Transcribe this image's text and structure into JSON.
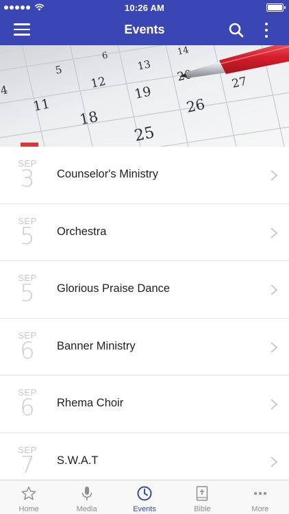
{
  "status_bar": {
    "time": "10:26 AM"
  },
  "nav": {
    "title": "Events"
  },
  "hero": {
    "calendar_numbers": [
      "4",
      "5",
      "6",
      "12",
      "13",
      "14",
      "11",
      "19",
      "20",
      "27",
      "18",
      "26",
      "25"
    ]
  },
  "events": [
    {
      "month": "SEP",
      "day": "3",
      "title": "Counselor's Ministry"
    },
    {
      "month": "SEP",
      "day": "5",
      "title": "Orchestra"
    },
    {
      "month": "SEP",
      "day": "5",
      "title": "Glorious Praise Dance"
    },
    {
      "month": "SEP",
      "day": "6",
      "title": "Banner Ministry"
    },
    {
      "month": "SEP",
      "day": "6",
      "title": "Rhema Choir"
    },
    {
      "month": "SEP",
      "day": "7",
      "title": "S.W.A.T"
    }
  ],
  "tabs": [
    {
      "label": "Home",
      "icon": "star-icon"
    },
    {
      "label": "Media",
      "icon": "microphone-icon"
    },
    {
      "label": "Events",
      "icon": "clock-icon",
      "active": true
    },
    {
      "label": "Bible",
      "icon": "bible-icon"
    },
    {
      "label": "More",
      "icon": "more-dots-icon"
    }
  ],
  "colors": {
    "primary": "#3a46b3",
    "tab_inactive": "#8e8e8e",
    "date_gray": "#c8c8c8"
  }
}
